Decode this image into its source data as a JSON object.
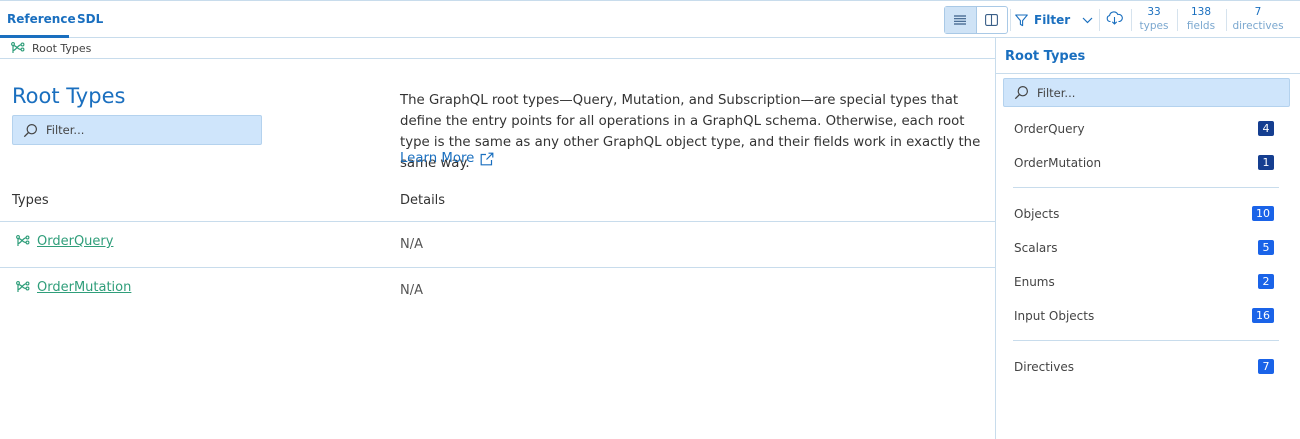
{
  "tabs": [
    {
      "label": "Reference"
    },
    {
      "label": "SDL"
    }
  ],
  "toolbar": {
    "filter_label": "Filter",
    "stats": [
      {
        "value": "33",
        "label": "types"
      },
      {
        "value": "138",
        "label": "fields"
      },
      {
        "value": "7",
        "label": "directives"
      }
    ]
  },
  "breadcrumb": {
    "label": "Root Types"
  },
  "main": {
    "title": "Root Types",
    "filter_placeholder": "Filter...",
    "description": "The GraphQL root types—Query, Mutation, and Subscription—are special types that define the entry points for all operations in a GraphQL schema. Otherwise, each root type is the same as any other GraphQL object type, and their fields work in exactly the same way.",
    "learn_more": "Learn More",
    "columns": [
      "Types",
      "Details"
    ],
    "rows": [
      {
        "name": "OrderQuery",
        "details": "N/A"
      },
      {
        "name": "OrderMutation",
        "details": "N/A"
      }
    ]
  },
  "panel": {
    "title": "Root Types",
    "filter_placeholder": "Filter...",
    "root_items": [
      {
        "label": "OrderQuery",
        "count": "4"
      },
      {
        "label": "OrderMutation",
        "count": "1"
      }
    ],
    "categories": [
      {
        "label": "Objects",
        "count": "10"
      },
      {
        "label": "Scalars",
        "count": "5"
      },
      {
        "label": "Enums",
        "count": "2"
      },
      {
        "label": "Input Objects",
        "count": "16"
      }
    ],
    "directives": {
      "label": "Directives",
      "count": "7"
    }
  },
  "colors": {
    "accent": "#1a6fbf",
    "link_green": "#2f9e7a",
    "badge_dark": "#153e90",
    "badge_blue": "#1a63e8",
    "filter_bg": "#cfe5fb"
  }
}
